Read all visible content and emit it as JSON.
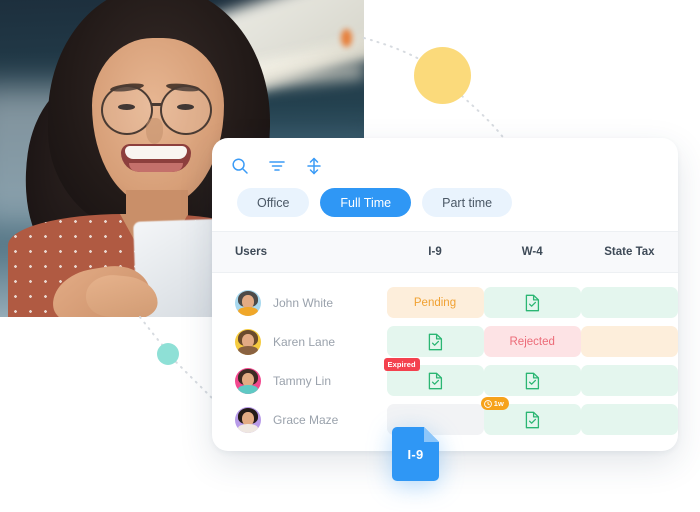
{
  "hero": {
    "photo_alt": "smiling-woman-at-laptop",
    "decorations": {
      "yellow_circle": "#fbda7b",
      "teal_circle": "#8ee0d6",
      "dashed_line_color": "#d7dbe0"
    }
  },
  "card": {
    "toolbar": {
      "icons": [
        {
          "name": "search-icon",
          "label": "Search"
        },
        {
          "name": "filter-icon",
          "label": "Filter"
        },
        {
          "name": "sort-icon",
          "label": "Sort"
        }
      ],
      "icon_color": "#3b9bf6"
    },
    "filter_chips": [
      {
        "label": "Office",
        "active": false
      },
      {
        "label": "Full Time",
        "active": true
      },
      {
        "label": "Part time",
        "active": false
      }
    ],
    "table": {
      "columns": [
        "Users",
        "I-9",
        "W-4",
        "State Tax"
      ],
      "rows": [
        {
          "name": "John White",
          "avatar_bg": "#a8d8ee",
          "avatar_hair": "#4c4a48",
          "avatar_body": "#f0a729",
          "cells": [
            {
              "column": "I-9",
              "style": "amber",
              "text": "Pending",
              "icon": null,
              "badge": null
            },
            {
              "column": "W-4",
              "style": "green",
              "text": "",
              "icon": "document-check-icon",
              "badge": null
            },
            {
              "column": "State Tax",
              "style": "green",
              "text": "",
              "icon": null,
              "badge": null
            }
          ]
        },
        {
          "name": "Karen Lane",
          "avatar_bg": "#f5cb3f",
          "avatar_hair": "#6a4a2c",
          "avatar_body": "#8a6240",
          "cells": [
            {
              "column": "I-9",
              "style": "green",
              "text": "",
              "icon": "document-check-icon",
              "badge": null
            },
            {
              "column": "W-4",
              "style": "red",
              "text": "Rejected",
              "icon": null,
              "badge": null
            },
            {
              "column": "State Tax",
              "style": "amber",
              "text": "",
              "icon": null,
              "badge": null
            }
          ]
        },
        {
          "name": "Tammy Lin",
          "avatar_bg": "#f2488f",
          "avatar_hair": "#3d2a23",
          "avatar_body": "#5fc9c4",
          "cells": [
            {
              "column": "I-9",
              "style": "green",
              "text": "",
              "icon": "document-check-icon",
              "badge": {
                "text": "Expired",
                "type": "red",
                "icon": null
              }
            },
            {
              "column": "W-4",
              "style": "green",
              "text": "",
              "icon": "document-check-icon",
              "badge": null
            },
            {
              "column": "State Tax",
              "style": "green",
              "text": "",
              "icon": null,
              "badge": null
            }
          ]
        },
        {
          "name": "Grace Maze",
          "avatar_bg": "#b79ae8",
          "avatar_hair": "#241b18",
          "avatar_body": "#efe7e1",
          "cells": [
            {
              "column": "I-9",
              "style": "grey",
              "text": "",
              "icon": null,
              "badge": null
            },
            {
              "column": "W-4",
              "style": "green",
              "text": "",
              "icon": "document-check-icon",
              "badge": {
                "text": "1w",
                "type": "orange",
                "icon": "clock-icon"
              }
            },
            {
              "column": "State Tax",
              "style": "green",
              "text": "",
              "icon": null,
              "badge": null
            }
          ]
        }
      ]
    }
  },
  "file_chip": {
    "label": "I-9",
    "icon": "document-icon",
    "color": "#2f97f5"
  }
}
